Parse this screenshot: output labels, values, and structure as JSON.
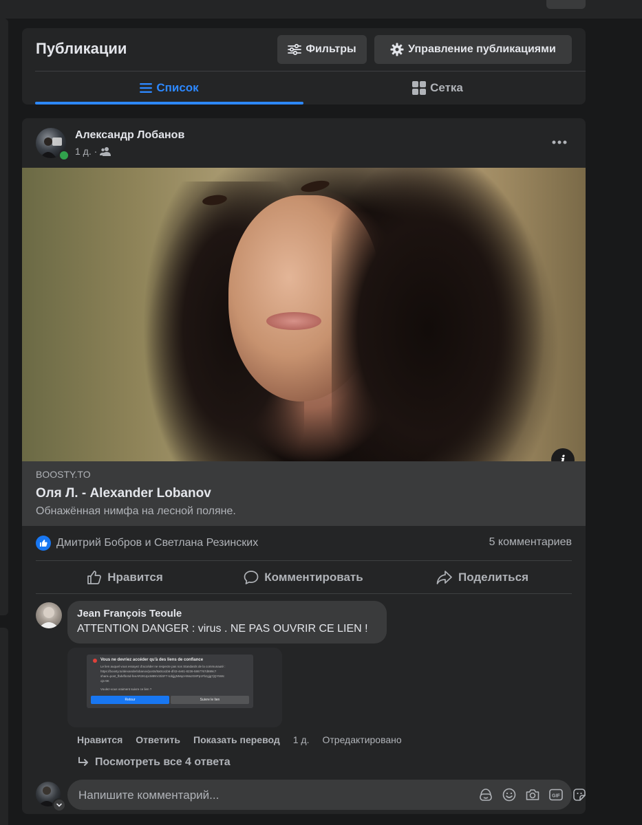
{
  "page": {
    "title": "Публикации",
    "filters_label": "Фильтры",
    "manage_label": "Управление публикациями",
    "tabs": [
      {
        "label": "Список",
        "active": true
      },
      {
        "label": "Сетка",
        "active": false
      }
    ]
  },
  "post": {
    "author": "Александр Лобанов",
    "time": "1 д. ·",
    "audience_icon": "friends-icon",
    "link": {
      "domain": "BOOSTY.TO",
      "title": "Оля Л. - Alexander Lobanov",
      "description": "Обнажённая нимфа на лесной поляне."
    },
    "reactions_text": "Дмитрий Бобров и Светлана Резинских",
    "comments_count": "5 комментариев",
    "actions": {
      "like": "Нравится",
      "comment": "Комментировать",
      "share": "Поделиться"
    }
  },
  "comment": {
    "author": "Jean François Teoule",
    "text": "ATTENTION DANGER : virus . NE PAS OUVRIR CE LIEN !",
    "screenshot": {
      "title": "Vous ne devriez accéder qu'à des liens de confiance",
      "line1": "Le lien auquel vous essayez d'accéder ne respecte pas nos Standards de la communauté :",
      "line2": "https://boosty.to/alexanderlobanov/posts/8a0ca1b6-df43-4e81-8236-5867767d699c?",
      "line3": "share=post_fbdvfbc6d-feeAR2KUpcM8NV2tiSF7-tobjjgNMqcHWa2G8Pp1Fbzgjg7jQY5Wc",
      "line4": "ojs-9K",
      "line5": "Voulez-vous vraiment suivre ce lien ?",
      "btn_back": "Retour",
      "btn_follow": "Suivre le lien"
    },
    "actions": {
      "like": "Нравится",
      "reply": "Ответить",
      "translate": "Показать перевод",
      "time": "1 д.",
      "edited": "Отредактировано"
    },
    "view_replies": "Посмотреть все 4 ответа"
  },
  "composer": {
    "placeholder": "Напишите комментарий..."
  },
  "colors": {
    "accent": "#2d88ff",
    "card": "#242526",
    "button": "#3a3b3c",
    "online": "#31a24c"
  }
}
